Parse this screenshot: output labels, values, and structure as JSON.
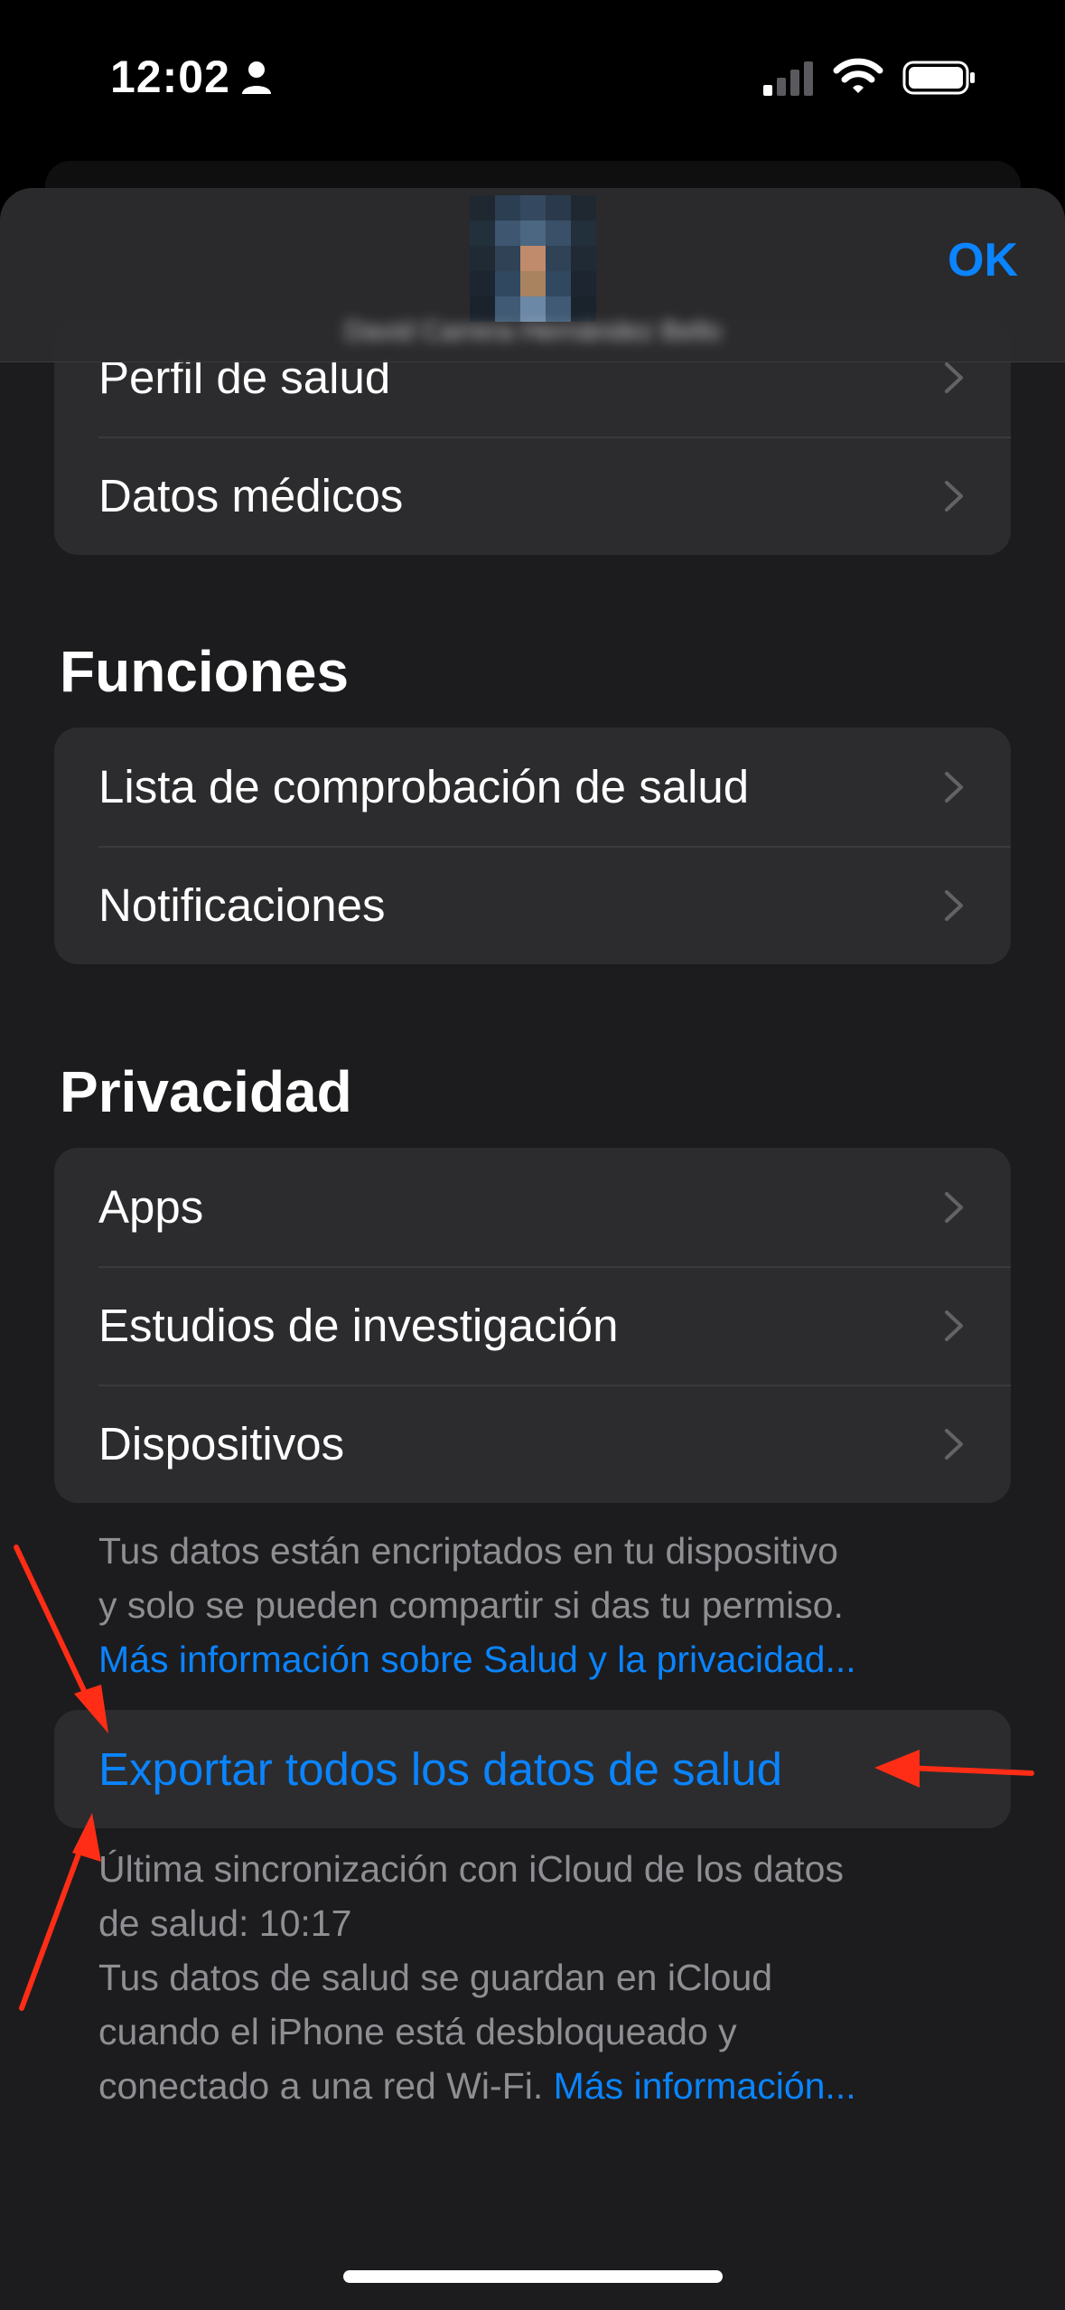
{
  "status_bar": {
    "time": "12:02",
    "icons": [
      "person-icon",
      "cellular-signal-icon",
      "wifi-icon",
      "battery-icon"
    ]
  },
  "nav": {
    "ok_label": "OK",
    "user_name": "David Carrera Hernández Bello"
  },
  "profile_group": {
    "items": [
      {
        "label": "Perfil de salud"
      },
      {
        "label": "Datos médicos"
      }
    ]
  },
  "funciones": {
    "title": "Funciones",
    "items": [
      {
        "label": "Lista de comprobación de salud"
      },
      {
        "label": "Notificaciones"
      }
    ]
  },
  "privacidad": {
    "title": "Privacidad",
    "items": [
      {
        "label": "Apps"
      },
      {
        "label": "Estudios de investigación"
      },
      {
        "label": "Dispositivos"
      }
    ],
    "footer_line1": "Tus datos están encriptados en tu dispositivo",
    "footer_line2": "y solo se pueden compartir si das tu permiso.",
    "footer_link": "Más información sobre Salud y la privacidad..."
  },
  "export": {
    "label": "Exportar todos los datos de salud",
    "sync_line1": "Última sincronización con iCloud de los datos",
    "sync_line2": "de salud: 10:17",
    "icloud_line1": "Tus datos de salud se guardan en iCloud",
    "icloud_line2": "cuando el iPhone está desbloqueado y",
    "icloud_line3": "conectado a una red Wi-Fi.",
    "more_link": "Más información..."
  },
  "colors": {
    "accent": "#0a84ff",
    "annotation_arrow": "#ff2d16",
    "background": "#1c1c1e",
    "cell": "#2c2c2e",
    "secondary_text": "#8e8e93"
  }
}
